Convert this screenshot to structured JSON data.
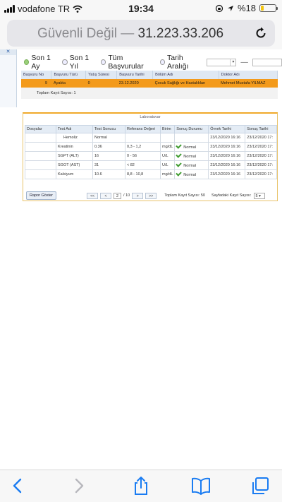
{
  "status_bar": {
    "carrier": "vodafone TR",
    "time": "19:34",
    "battery": "%18"
  },
  "urlbar": {
    "security": "Güvenli Değil —",
    "address": "31.223.33.206"
  },
  "filters": {
    "options": [
      "Son 1 Ay",
      "Son 1 Yıl",
      "Tüm Başvurular",
      "Tarih Aralığı"
    ],
    "separator": "—"
  },
  "applications": {
    "headers": [
      "Başvuru No",
      "Başvuru Türü",
      "Yatış Süresi",
      "Başvuru Tarihi",
      "Bölüm Adı",
      "Doktor Adı"
    ],
    "row": [
      "9",
      "Ayakta",
      "0",
      "23.12.2020",
      "Çocuk Sağlığı ve Hastalıkları",
      "Mehmet Mustafa YILMAZ"
    ],
    "total": "Toplam Kayıt Sayısı: 1"
  },
  "laboratory": {
    "title": "Laboratuvar",
    "headers": [
      "Dosyalar",
      "Test Adı",
      "Test Sonucu",
      "Referans Değeri",
      "Birim",
      "Sonuç Durumu",
      "Örnek Tarihi",
      "Sonuç Tarihi"
    ],
    "rows": [
      {
        "file": "",
        "test": "Hemoliz",
        "result": "Normal",
        "ref": "",
        "unit": "",
        "status": "",
        "sample_date": "23/12/2020 16:16",
        "result_date": "23/12/2020 17:"
      },
      {
        "file": "",
        "test": "Kreatinin",
        "result": "0.36",
        "ref": "0,3 - 1,2",
        "unit": "mg/dL",
        "status": "Normal",
        "sample_date": "23/12/2020 16:16",
        "result_date": "23/12/2020 17:"
      },
      {
        "file": "",
        "test": "SGPT (ALT)",
        "result": "16",
        "ref": "0 - 56",
        "unit": "U/L",
        "status": "Normal",
        "sample_date": "23/12/2020 16:16",
        "result_date": "23/12/2020 17:"
      },
      {
        "file": "",
        "test": "SGOT (AST)",
        "result": "31",
        "ref": "< 82",
        "unit": "U/L",
        "status": "Normal",
        "sample_date": "23/12/2020 16:16",
        "result_date": "23/12/2020 17:"
      },
      {
        "file": "",
        "test": "Kalsiyum",
        "result": "10.6",
        "ref": "8,8 - 10,8",
        "unit": "mg/dL",
        "status": "Normal",
        "sample_date": "23/12/2020 16:16",
        "result_date": "23/12/2020 17:"
      }
    ],
    "report_button": "Rapor Göster",
    "pager": {
      "first": "<<",
      "prev": "<",
      "page": "2",
      "of": "/ 10",
      "next": ">",
      "last": ">>",
      "total": "Toplam Kayıt Sayısı: 50",
      "per_page_label": "Sayfadaki Kayıt Sayısı:",
      "per_page": "5"
    }
  },
  "colors": {
    "accent_orange": "#f39a1b",
    "ios_blue": "#1a7cf2",
    "normal_green": "#3e9b2f"
  },
  "toolbar_icons": [
    "back-icon",
    "forward-icon",
    "share-icon",
    "bookmarks-icon",
    "tabs-icon"
  ]
}
